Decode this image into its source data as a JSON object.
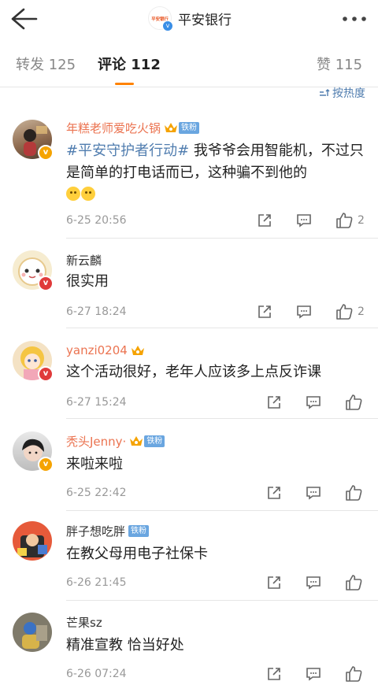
{
  "header": {
    "title": "平安银行",
    "logo_text": "平安银行",
    "verified_badge": "v"
  },
  "tabs": [
    {
      "label": "转发 125"
    },
    {
      "label": "评论 112"
    },
    {
      "label": "赞 115"
    }
  ],
  "sort_label": "按热度",
  "comments": [
    {
      "name": "年糕老师爱吃火锅",
      "fan_tag": "铁粉",
      "text_tag": "#平安守护者行动#",
      "text": " 我爷爷会用智能机，不过只是简单的打电话而已，这种骗不到他的",
      "time": "6-25 20:56",
      "likes": "2"
    },
    {
      "name": "新云麟",
      "text": "很实用",
      "time": "6-27 18:24",
      "likes": "2"
    },
    {
      "name": "yanzi0204",
      "text": "这个活动很好，老年人应该多上点反诈课",
      "time": "6-27 15:24",
      "likes": ""
    },
    {
      "name": "秃头Jenny·",
      "fan_tag": "铁粉",
      "text": "来啦来啦",
      "time": "6-25 22:42",
      "likes": ""
    },
    {
      "name": "胖子想吃胖",
      "fan_tag": "铁粉",
      "text": "在教父母用电子社保卡",
      "time": "6-26 21:45",
      "likes": ""
    },
    {
      "name": "芒果sz",
      "text": "精准宣教 恰当好处",
      "time": "6-26 07:24",
      "likes": ""
    }
  ],
  "colors": {
    "accent": "#ff8200",
    "link": "#507daf",
    "name_orange": "#eb7350"
  },
  "icons": [
    "back-arrow-icon",
    "more-icon",
    "sort-icon",
    "share-icon",
    "comment-icon",
    "like-icon",
    "crown-icon"
  ]
}
